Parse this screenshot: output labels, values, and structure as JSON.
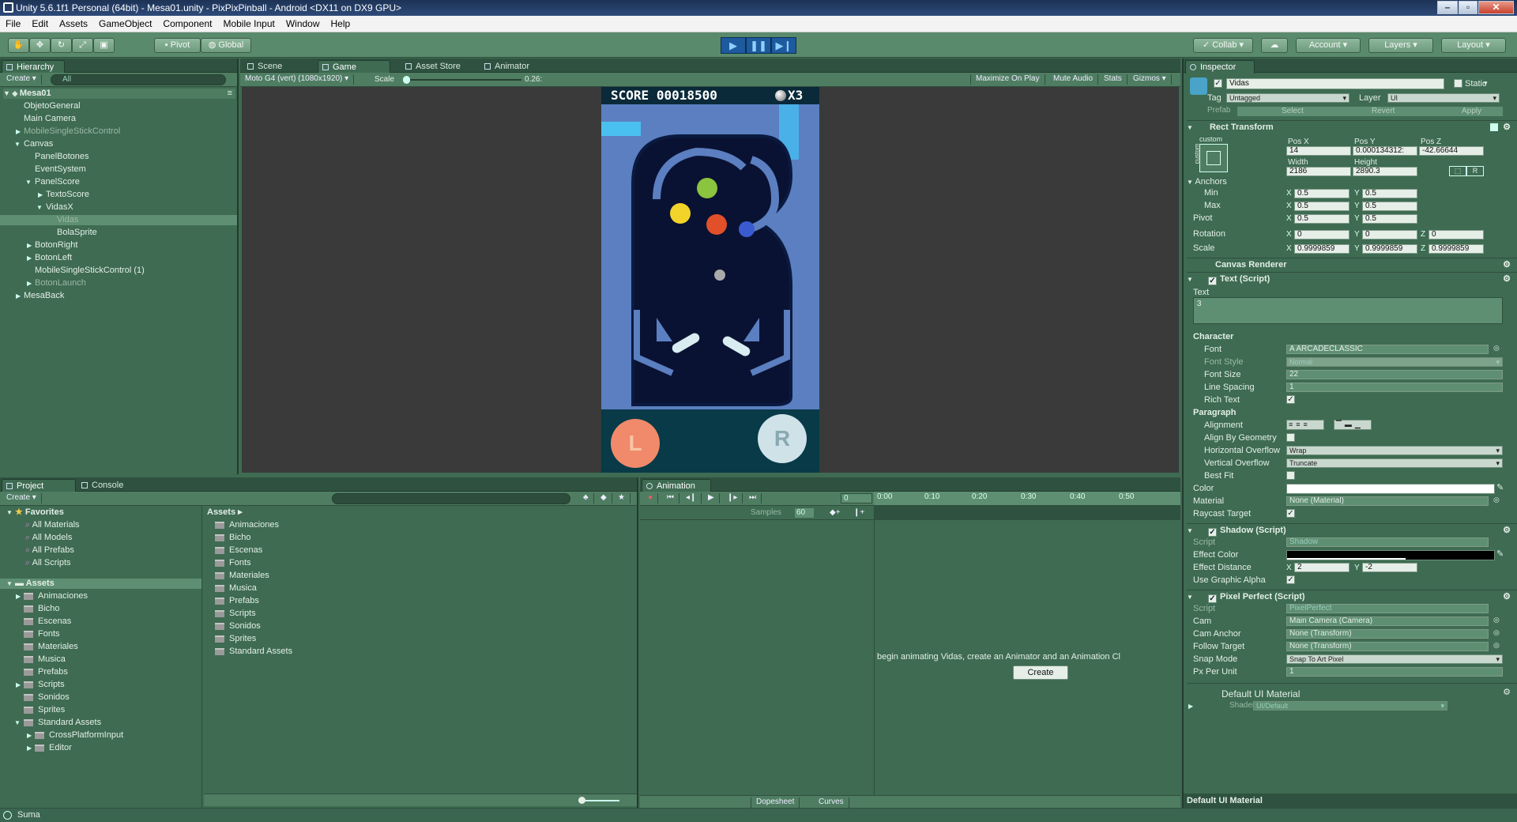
{
  "window": {
    "title": "Unity 5.6.1f1 Personal (64bit) - Mesa01.unity - PixPixPinball - Android <DX11 on DX9 GPU>"
  },
  "menu": [
    "File",
    "Edit",
    "Assets",
    "GameObject",
    "Component",
    "Mobile Input",
    "Window",
    "Help"
  ],
  "toolbar": {
    "pivot": "Pivot",
    "global": "Global",
    "collab": "Collab",
    "account": "Account",
    "layers": "Layers",
    "layout": "Layout"
  },
  "hierarchy": {
    "tab": "Hierarchy",
    "create": "Create",
    "search_placeholder": "All",
    "scene": "Mesa01",
    "items": [
      "ObjetoGeneral",
      "Main Camera",
      "MobileSingleStickControl",
      "Canvas",
      "PanelBotones",
      "EventSystem",
      "PanelScore",
      "TextoScore",
      "VidasX",
      "Vidas",
      "BolaSprite",
      "BotonRight",
      "BotonLeft",
      "MobileSingleStickControl (1)",
      "BotonLaunch",
      "MesaBack"
    ]
  },
  "game": {
    "tabs": [
      "Scene",
      "Game",
      "Asset Store",
      "Animator"
    ],
    "resolution": "Moto G4 (vert) (1080x1920)",
    "scale_label": "Scale",
    "scale_value": "0.26:",
    "buttons": [
      "Maximize On Play",
      "Mute Audio",
      "Stats",
      "Gizmos"
    ],
    "score_label": "SCORE",
    "score": "00018500",
    "lives": "X3",
    "btn_left": "L",
    "btn_right": "R"
  },
  "project": {
    "tabs": [
      "Project",
      "Console"
    ],
    "create": "Create",
    "favorites_label": "Favorites",
    "favorites": [
      "All Materials",
      "All Models",
      "All Prefabs",
      "All Scripts"
    ],
    "assets_label": "Assets",
    "tree": [
      "Animaciones",
      "Bicho",
      "Escenas",
      "Fonts",
      "Materiales",
      "Musica",
      "Prefabs",
      "Scripts",
      "Sonidos",
      "Sprites",
      "Standard Assets",
      "CrossPlatformInput",
      "Editor"
    ],
    "breadcrumb": "Assets",
    "files": [
      "Animaciones",
      "Bicho",
      "Escenas",
      "Fonts",
      "Materiales",
      "Musica",
      "Prefabs",
      "Scripts",
      "Sonidos",
      "Sprites",
      "Standard Assets"
    ]
  },
  "animation": {
    "tab": "Animation",
    "samples_label": "Samples",
    "samples": "60",
    "frame": "0",
    "ticks": [
      "0:00",
      "0:10",
      "0:20",
      "0:30",
      "0:40",
      "0:50"
    ],
    "message": "begin animating Vidas, create an Animator and an Animation Cl",
    "create_button": "Create",
    "dopesheet": "Dopesheet",
    "curves": "Curves"
  },
  "inspector": {
    "tab": "Inspector",
    "name": "Vidas",
    "static": "Static",
    "tag_label": "Tag",
    "tag": "Untagged",
    "layer_label": "Layer",
    "layer": "UI",
    "prefab": "Prefab",
    "select": "Select",
    "revert": "Revert",
    "apply": "Apply",
    "rect": {
      "title": "Rect Transform",
      "custom": "custom",
      "side": "custom",
      "posx_label": "Pos X",
      "posy_label": "Pos Y",
      "posz_label": "Pos Z",
      "posx": "14",
      "posy": "0.000134312:",
      "posz": "-42.66644",
      "width_label": "Width",
      "height_label": "Height",
      "width": "2186",
      "height": "2890.3",
      "anchors": "Anchors",
      "min": "Min",
      "max": "Max",
      "pivot": "Pivot",
      "min_x": "0.5",
      "min_y": "0.5",
      "max_x": "0.5",
      "max_y": "0.5",
      "pivot_x": "0.5",
      "pivot_y": "0.5",
      "rotation": "Rotation",
      "rot_x": "0",
      "rot_y": "0",
      "rot_z": "0",
      "scale": "Scale",
      "sc_x": "0.9999859",
      "sc_y": "0.9999859",
      "sc_z": "0.9999859",
      "r": "R"
    },
    "canvas_renderer": "Canvas Renderer",
    "text": {
      "title": "Text (Script)",
      "text_label": "Text",
      "text_value": "3",
      "character": "Character",
      "font_label": "Font",
      "font": "ARCADECLASSIC",
      "font_style_label": "Font Style",
      "font_style": "Normal",
      "font_size_label": "Font Size",
      "font_size": "22",
      "line_spacing_label": "Line Spacing",
      "line_spacing": "1",
      "rich_text_label": "Rich Text",
      "paragraph": "Paragraph",
      "alignment_label": "Alignment",
      "align_geometry_label": "Align By Geometry",
      "h_overflow_label": "Horizontal Overflow",
      "h_overflow": "Wrap",
      "v_overflow_label": "Vertical Overflow",
      "v_overflow": "Truncate",
      "best_fit_label": "Best Fit",
      "color_label": "Color",
      "material_label": "Material",
      "material": "None (Material)",
      "raycast_label": "Raycast Target"
    },
    "shadow": {
      "title": "Shadow (Script)",
      "script_label": "Script",
      "script": "Shadow",
      "effect_color_label": "Effect Color",
      "effect_distance_label": "Effect Distance",
      "dist_x": "2",
      "dist_y": "-2",
      "use_alpha_label": "Use Graphic Alpha"
    },
    "pixel": {
      "title": "Pixel Perfect (Script)",
      "script_label": "Script",
      "script": "PixelPerfect",
      "cam_label": "Cam",
      "cam": "Main Camera (Camera)",
      "cam_anchor_label": "Cam Anchor",
      "cam_anchor": "None (Transform)",
      "follow_label": "Follow Target",
      "follow": "None (Transform)",
      "snap_label": "Snap Mode",
      "snap": "Snap To Art Pixel",
      "ppu_label": "Px Per Unit",
      "ppu": "1"
    },
    "material": {
      "title": "Default UI Material",
      "shader_label": "Shader",
      "shader": "UI/Default",
      "footer": "Default UI Material"
    }
  },
  "status": "Suma",
  "colors": {
    "bg": "#3e6b52",
    "board": "#5b7fc0",
    "track": "#0a1233",
    "score_bar": "#0a2a3a",
    "btn_left": "#f08a6a",
    "btn_right": "#cfe2e8"
  }
}
